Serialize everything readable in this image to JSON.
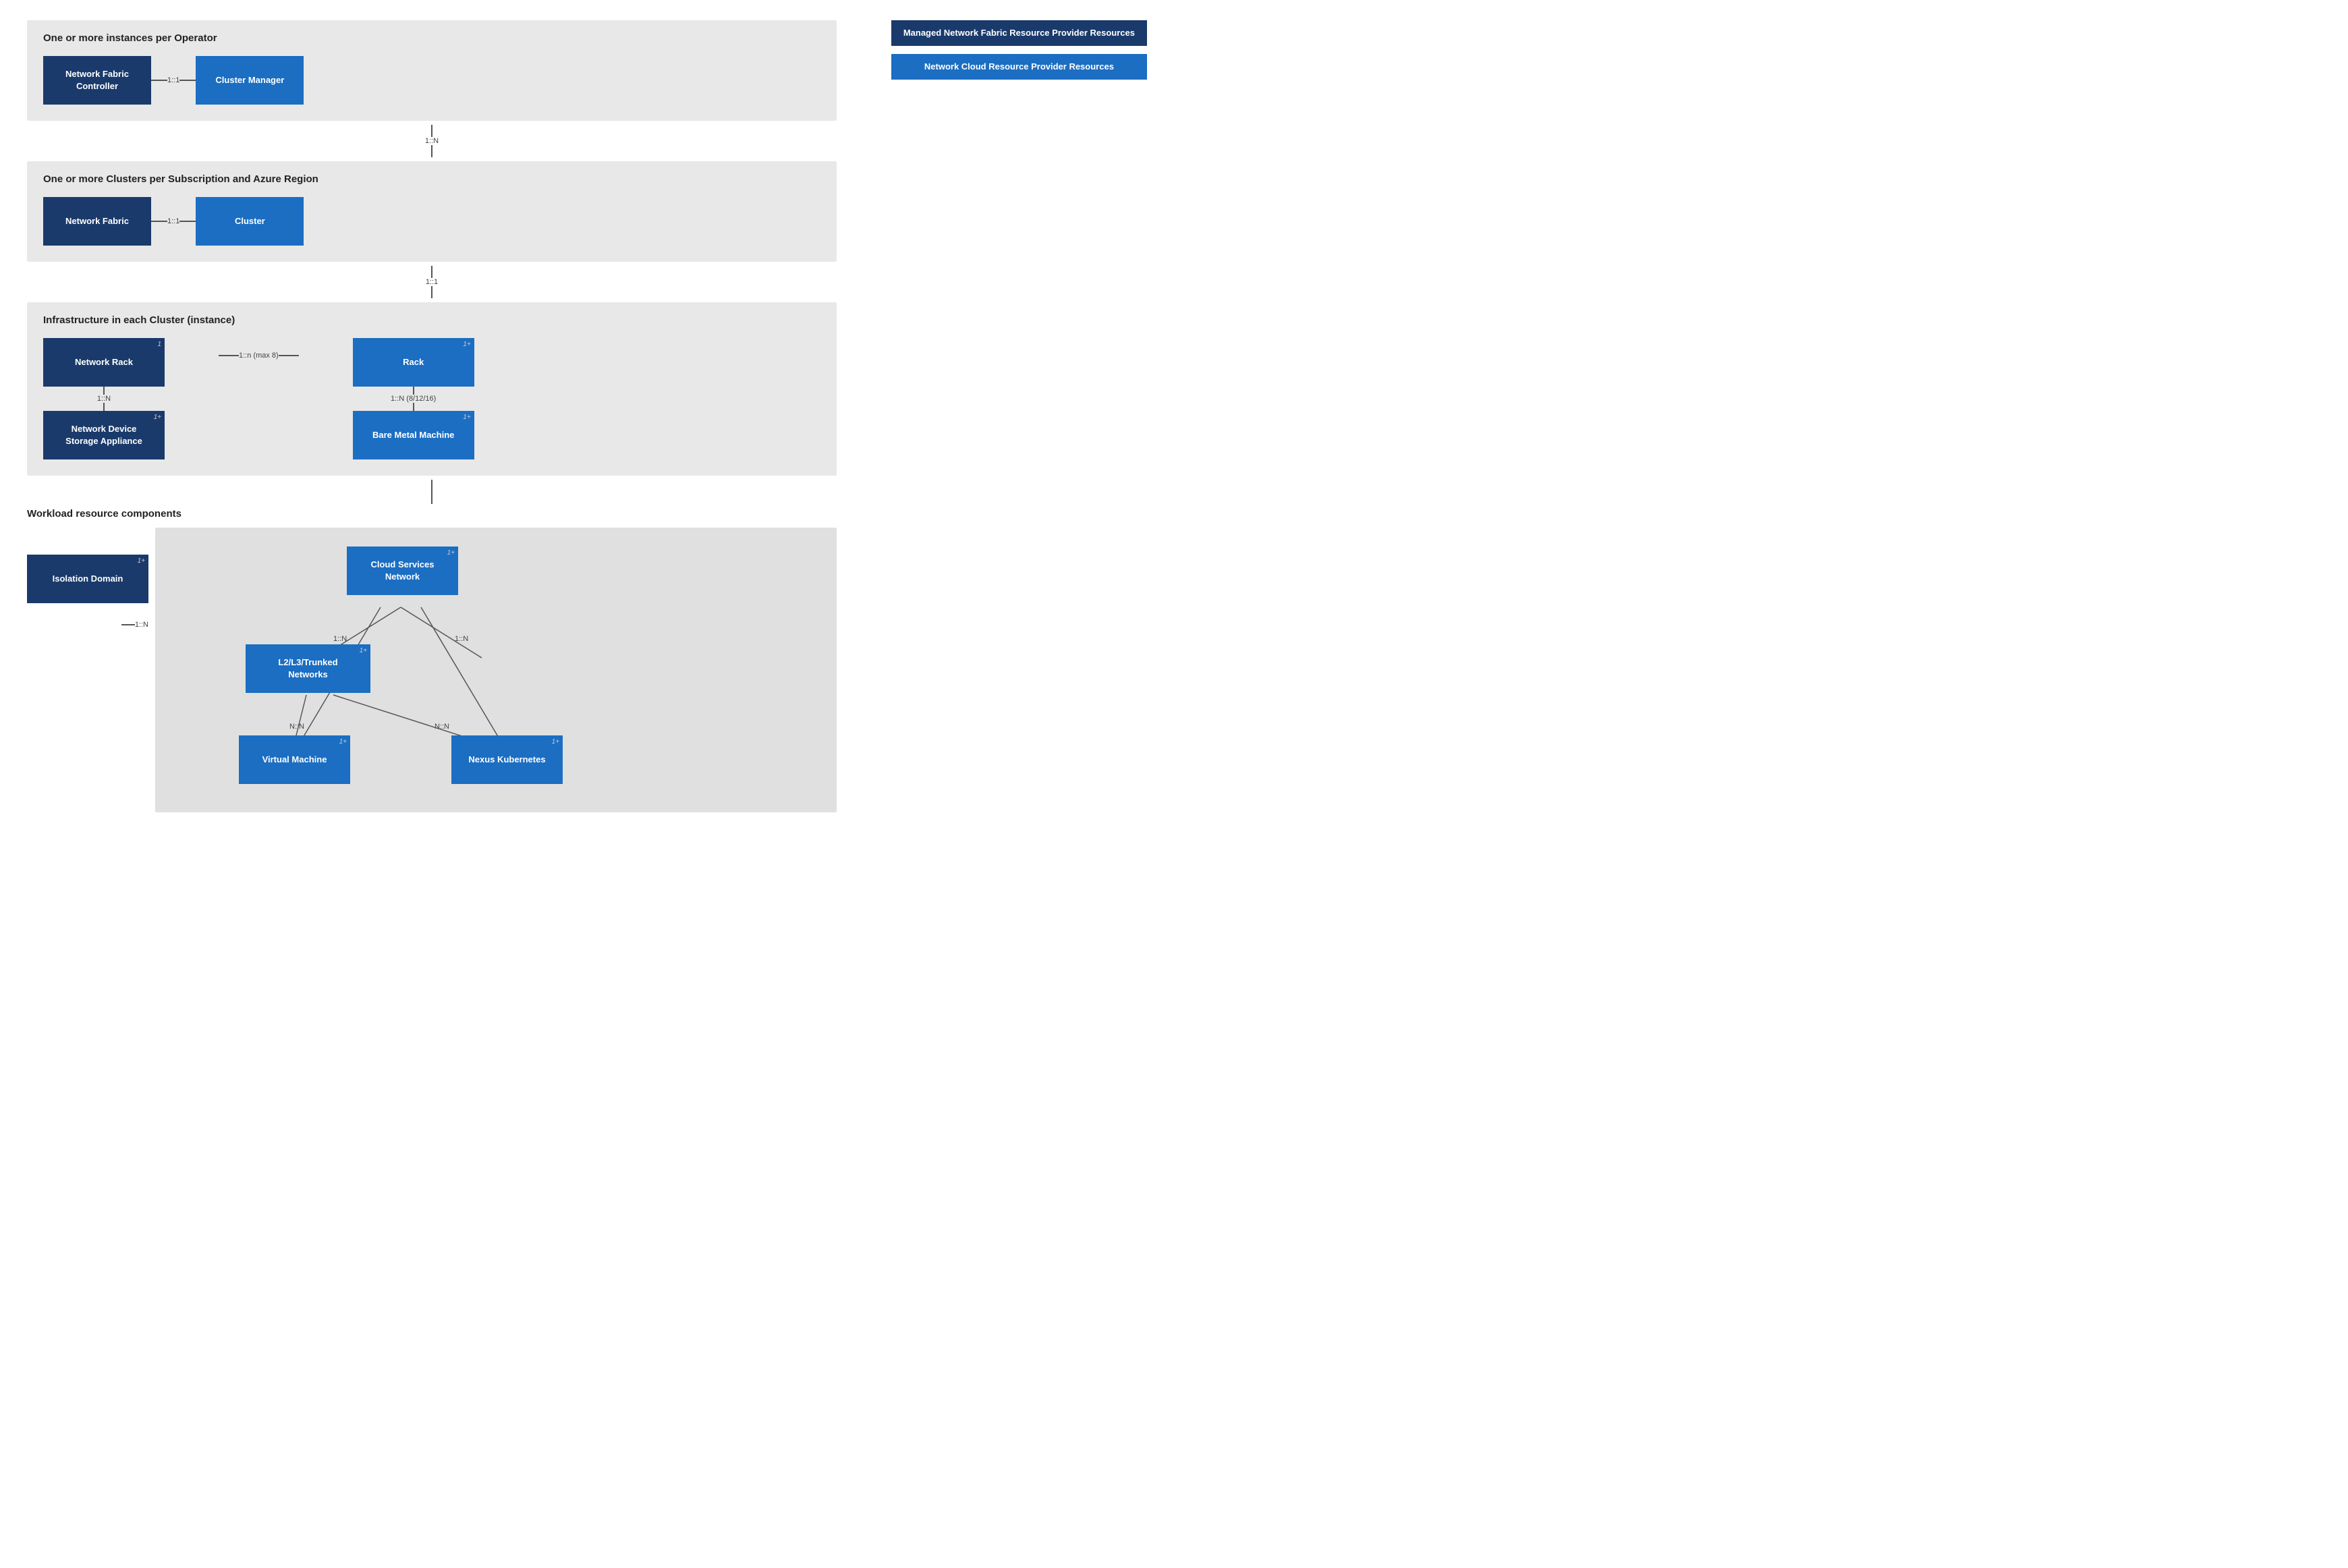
{
  "legend": {
    "item1": "Managed Network Fabric Resource Provider Resources",
    "item2": "Network Cloud Resource Provider Resources"
  },
  "section1": {
    "title": "One or more instances per Operator",
    "nfc_label": "Network Fabric Controller",
    "cluster_manager_label": "Cluster Manager",
    "conn1_label": "1::1",
    "conn2_label": "1::N"
  },
  "section2": {
    "title": "One or more Clusters per Subscription and Azure Region",
    "nf_label": "Network Fabric",
    "cluster_label": "Cluster",
    "conn1_label": "1::1",
    "conn2_label": "1::1"
  },
  "section3": {
    "title": "Infrastructure in each Cluster (instance)",
    "nr_label": "Network Rack",
    "nr_badge": "1",
    "ndsa_label": "Network Device Storage Appliance",
    "ndsa_badge": "1+",
    "rack_label": "Rack",
    "rack_badge": "1+",
    "bmm_label": "Bare Metal Machine",
    "bmm_badge": "1+",
    "conn_nr_rack": "1::n (max 8)",
    "conn_nr_ndsa": "1::N",
    "conn_rack_bmm": "1::N (8/12/16)"
  },
  "section4": {
    "title": "Workload resource components",
    "isolation_domain_label": "Isolation Domain",
    "isolation_domain_badge": "1+",
    "conn_iso": "1::N",
    "csn_label": "Cloud Services Network",
    "csn_badge": "1+",
    "l2l3_label": "L2/L3/Trunked Networks",
    "l2l3_badge": "1+",
    "conn_csn_l2l3_1": "1::N",
    "conn_csn_l2l3_2": "1::N",
    "vm_label": "Virtual Machine",
    "vm_badge": "1+",
    "nk_label": "Nexus Kubernetes",
    "nk_badge": "1+",
    "conn_nn1": "N::N",
    "conn_nn2": "N::N"
  }
}
